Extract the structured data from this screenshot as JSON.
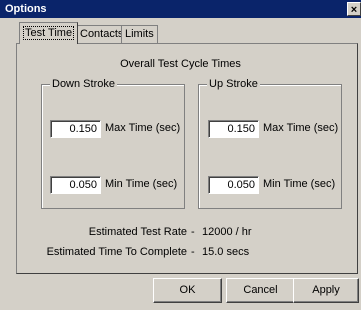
{
  "window": {
    "title": "Options",
    "close_glyph": "×"
  },
  "tabs": [
    {
      "label": "Test Time",
      "active": true
    },
    {
      "label": "Contacts",
      "active": false
    },
    {
      "label": "Limits",
      "active": false
    }
  ],
  "panel": {
    "heading": "Overall Test Cycle Times",
    "down_stroke": {
      "label": "Down Stroke",
      "max_value": "0.150",
      "max_label": "Max Time (sec)",
      "min_value": "0.050",
      "min_label": "Min Time (sec)"
    },
    "up_stroke": {
      "label": "Up Stroke",
      "max_value": "0.150",
      "max_label": "Max Time (sec)",
      "min_value": "0.050",
      "min_label": "Min Time (sec)"
    },
    "estimated_rate": {
      "label": "Estimated Test Rate",
      "separator": "-",
      "value": "12000 / hr"
    },
    "estimated_time": {
      "label": "Estimated Time To Complete",
      "separator": "-",
      "value": "15.0 secs"
    }
  },
  "buttons": {
    "ok": "OK",
    "cancel": "Cancel",
    "apply": "Apply"
  },
  "colors": {
    "titlebar": "#0a246a",
    "face": "#d4d0c8"
  }
}
